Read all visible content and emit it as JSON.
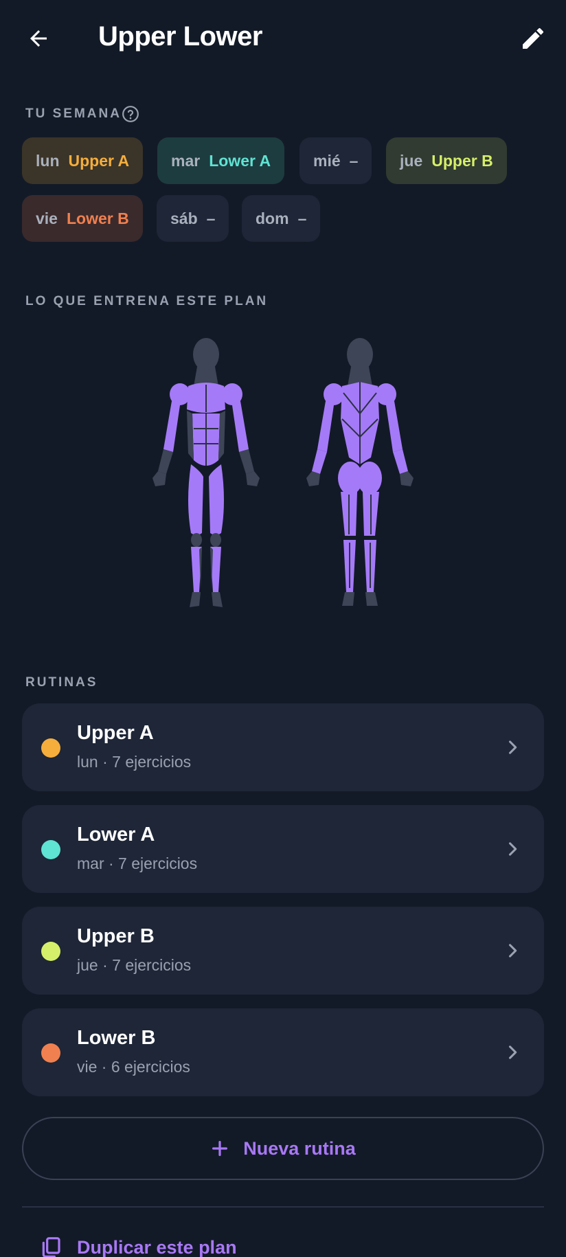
{
  "header": {
    "title": "Upper Lower"
  },
  "week": {
    "label": "TU SEMANA",
    "days": [
      {
        "day": "lun",
        "routine": "Upper A",
        "color": "#f5ae3c"
      },
      {
        "day": "mar",
        "routine": "Lower A",
        "color": "#5fe3d2"
      },
      {
        "day": "mié",
        "routine": "–",
        "color": ""
      },
      {
        "day": "jue",
        "routine": "Upper B",
        "color": "#d6ef6a"
      },
      {
        "day": "vie",
        "routine": "Lower B",
        "color": "#f0804f"
      },
      {
        "day": "sáb",
        "routine": "–",
        "color": ""
      },
      {
        "day": "dom",
        "routine": "–",
        "color": ""
      }
    ]
  },
  "muscles": {
    "label": "LO QUE ENTRENA ESTE PLAN",
    "highlight_color": "#a57af8",
    "base_color": "#3d4556"
  },
  "routines": {
    "label": "RUTINAS",
    "items": [
      {
        "name": "Upper A",
        "meta": "lun · 7 ejercicios",
        "color": "#f5ae3c"
      },
      {
        "name": "Lower A",
        "meta": "mar · 7 ejercicios",
        "color": "#5fe3d2"
      },
      {
        "name": "Upper B",
        "meta": "jue · 7 ejercicios",
        "color": "#d6ef6a"
      },
      {
        "name": "Lower B",
        "meta": "vie · 6 ejercicios",
        "color": "#f0804f"
      }
    ]
  },
  "actions": {
    "new_routine": "Nueva rutina",
    "duplicate_plan": "Duplicar este plan"
  },
  "icons": {
    "back": "arrow-left-icon",
    "edit": "pencil-icon",
    "help": "question-circle-icon",
    "chevron": "chevron-right-icon",
    "plus": "plus-icon",
    "duplicate": "copy-icon"
  }
}
